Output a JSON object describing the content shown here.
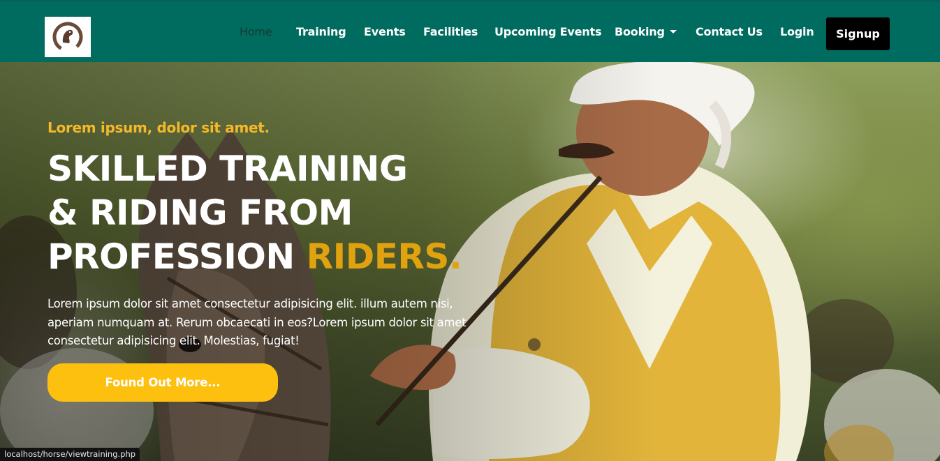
{
  "logo": {
    "icon": "horseshoe-icon",
    "alt": "horse logo"
  },
  "nav": {
    "home": "Home",
    "training": "Training",
    "events": "Events",
    "facilities": "Facilities",
    "upcoming_events": "Upcoming Events",
    "booking": "Booking",
    "contact_us": "Contact Us",
    "login": "Login",
    "signup": "Signup"
  },
  "hero": {
    "kicker": "Lorem ipsum, dolor sit amet.",
    "headline_line1": "SKILLED TRAINING",
    "headline_line2": "& RIDING FROM",
    "headline_line3_start": "PROFESSION",
    "headline_accent": "RIDERS.",
    "lead": "Lorem ipsum dolor sit amet consectetur adipisicing elit. illum autem nisi, aperiam numquam at. Rerum obcaecati in eos?Lorem ipsum dolor sit amet consectetur adipisicing elit. Molestias, fugiat!",
    "cta": "Found Out More..."
  },
  "status_bar": {
    "url": "localhost/horse/viewtraining.php"
  },
  "colors": {
    "navbar": "#006b5f",
    "accent_yellow": "#e0a30f",
    "cta_yellow": "#fdc00f",
    "signup_bg": "#000000"
  }
}
